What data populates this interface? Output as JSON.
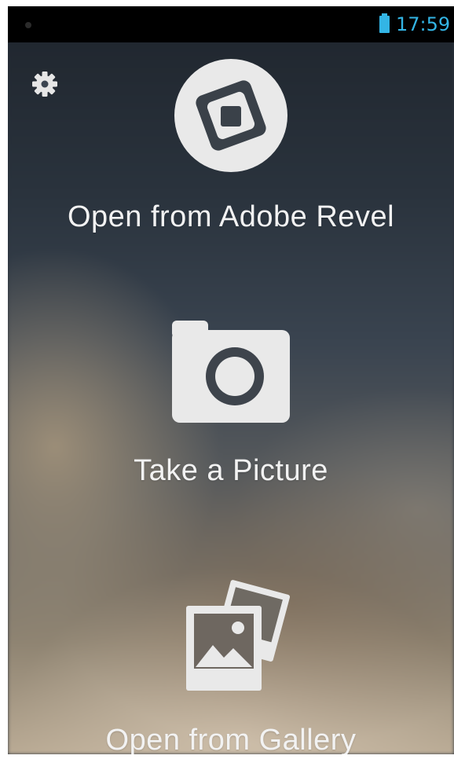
{
  "status_bar": {
    "time": "17:59",
    "battery_icon": "battery-icon",
    "notification_icon": "notification-dot-icon"
  },
  "settings": {
    "icon": "gear-icon"
  },
  "actions": [
    {
      "label": "Open from Adobe Revel",
      "icon": "adobe-revel-icon"
    },
    {
      "label": "Take a Picture",
      "icon": "camera-icon"
    },
    {
      "label": "Open from Gallery",
      "icon": "gallery-icon"
    }
  ],
  "colors": {
    "status_accent": "#33b5e5",
    "icon_fill": "#e9e9e9",
    "label_text": "#f2f2f2"
  }
}
